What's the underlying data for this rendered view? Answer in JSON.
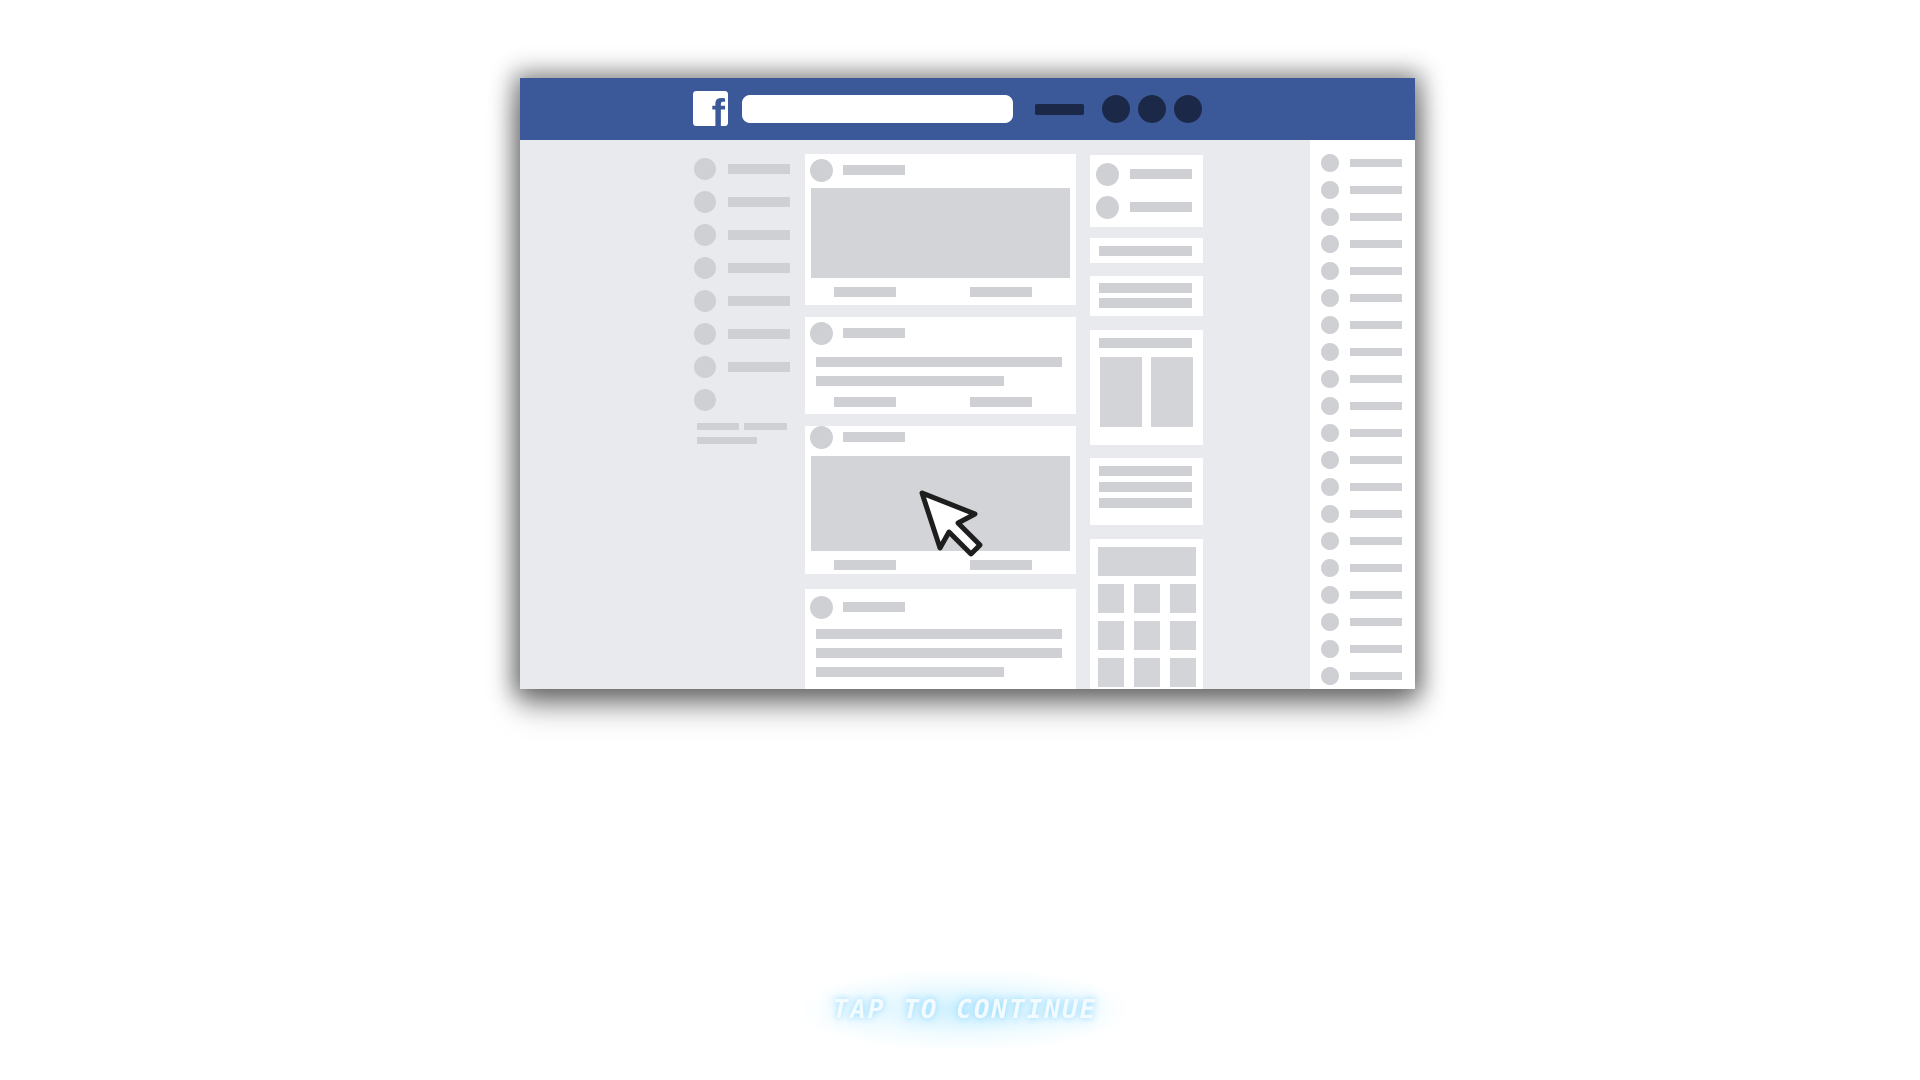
{
  "app": {
    "name": "Facebook",
    "logo_letter": "f"
  },
  "colors": {
    "topbar": "#3b5998",
    "nav_icons": "#1c2847",
    "page_background": "#e9eaed",
    "placeholder": "#cfd0d4",
    "card": "#ffffff"
  },
  "icons": {
    "logo": "facebook-logo-icon",
    "cursor": "mouse-pointer-icon",
    "nav": [
      "menu-icon",
      "friend-requests-icon",
      "messages-icon",
      "notifications-icon"
    ]
  },
  "search": {
    "placeholder": ""
  },
  "prompt": {
    "label": "TAP TO CONTINUE"
  }
}
